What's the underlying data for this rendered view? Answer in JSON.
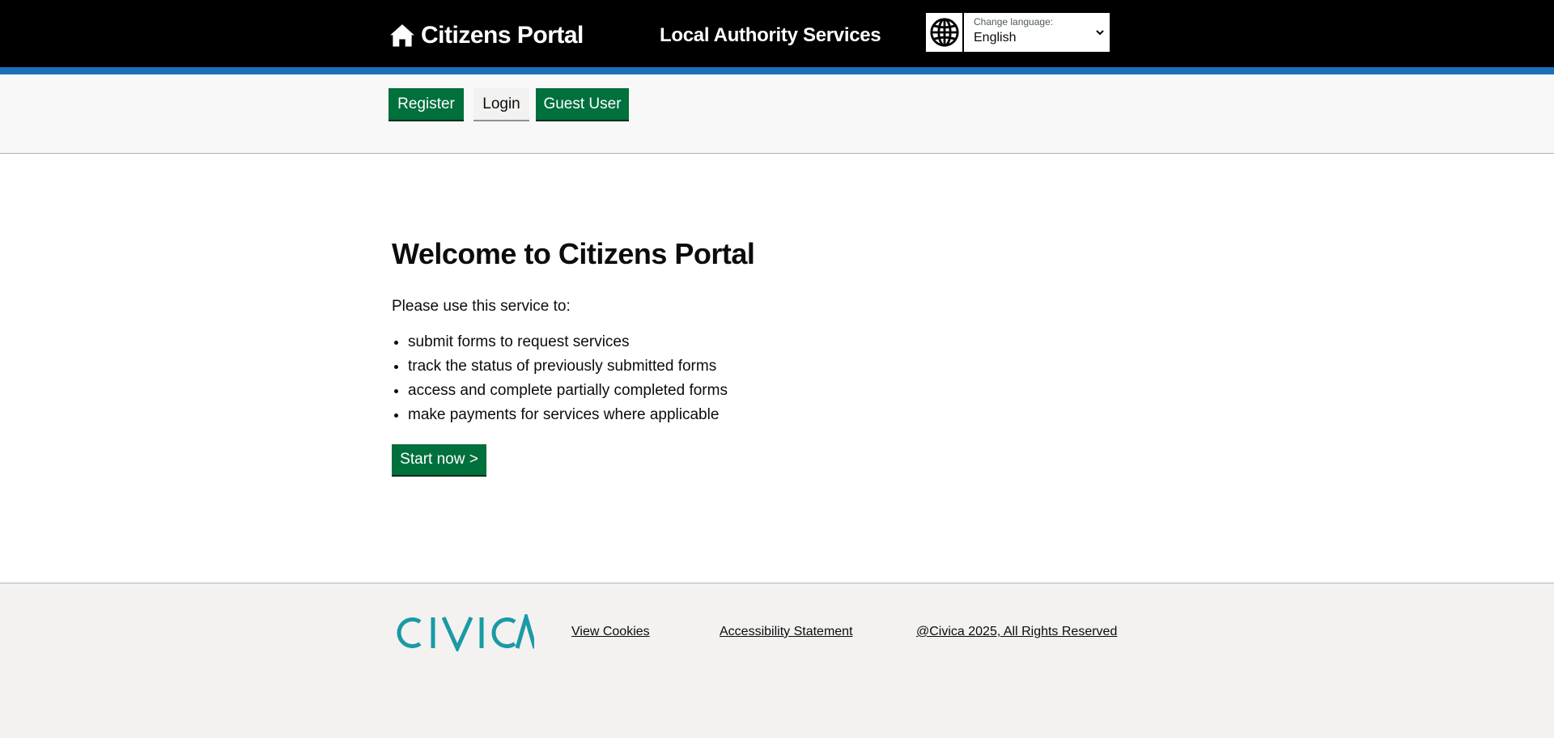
{
  "header": {
    "brand_title": "Citizens Portal",
    "service_name": "Local Authority Services",
    "language": {
      "label": "Change language:",
      "selected": "English"
    }
  },
  "nav": {
    "register_label": "Register",
    "login_label": "Login",
    "guest_label": "Guest User"
  },
  "main": {
    "title": "Welcome to Citizens Portal",
    "intro": "Please use this service to:",
    "bullets": [
      "submit forms to request services",
      "track the status of previously submitted forms",
      "access and complete partially completed forms",
      "make payments for services where applicable"
    ],
    "start_label": "Start now >"
  },
  "footer": {
    "logo_text": "CIVICA",
    "cookies_link": "View Cookies",
    "accessibility_link": "Accessibility Statement",
    "copyright": "@Civica 2025, All Rights Reserved"
  },
  "colors": {
    "header_bg": "#000000",
    "header_stripe": "#1d70b8",
    "button_green": "#00703c",
    "brand_teal": "#1a9aa5"
  },
  "icons": {
    "brand": "home-icon",
    "language": "globe-icon",
    "dropdown": "chevron-down-icon"
  }
}
